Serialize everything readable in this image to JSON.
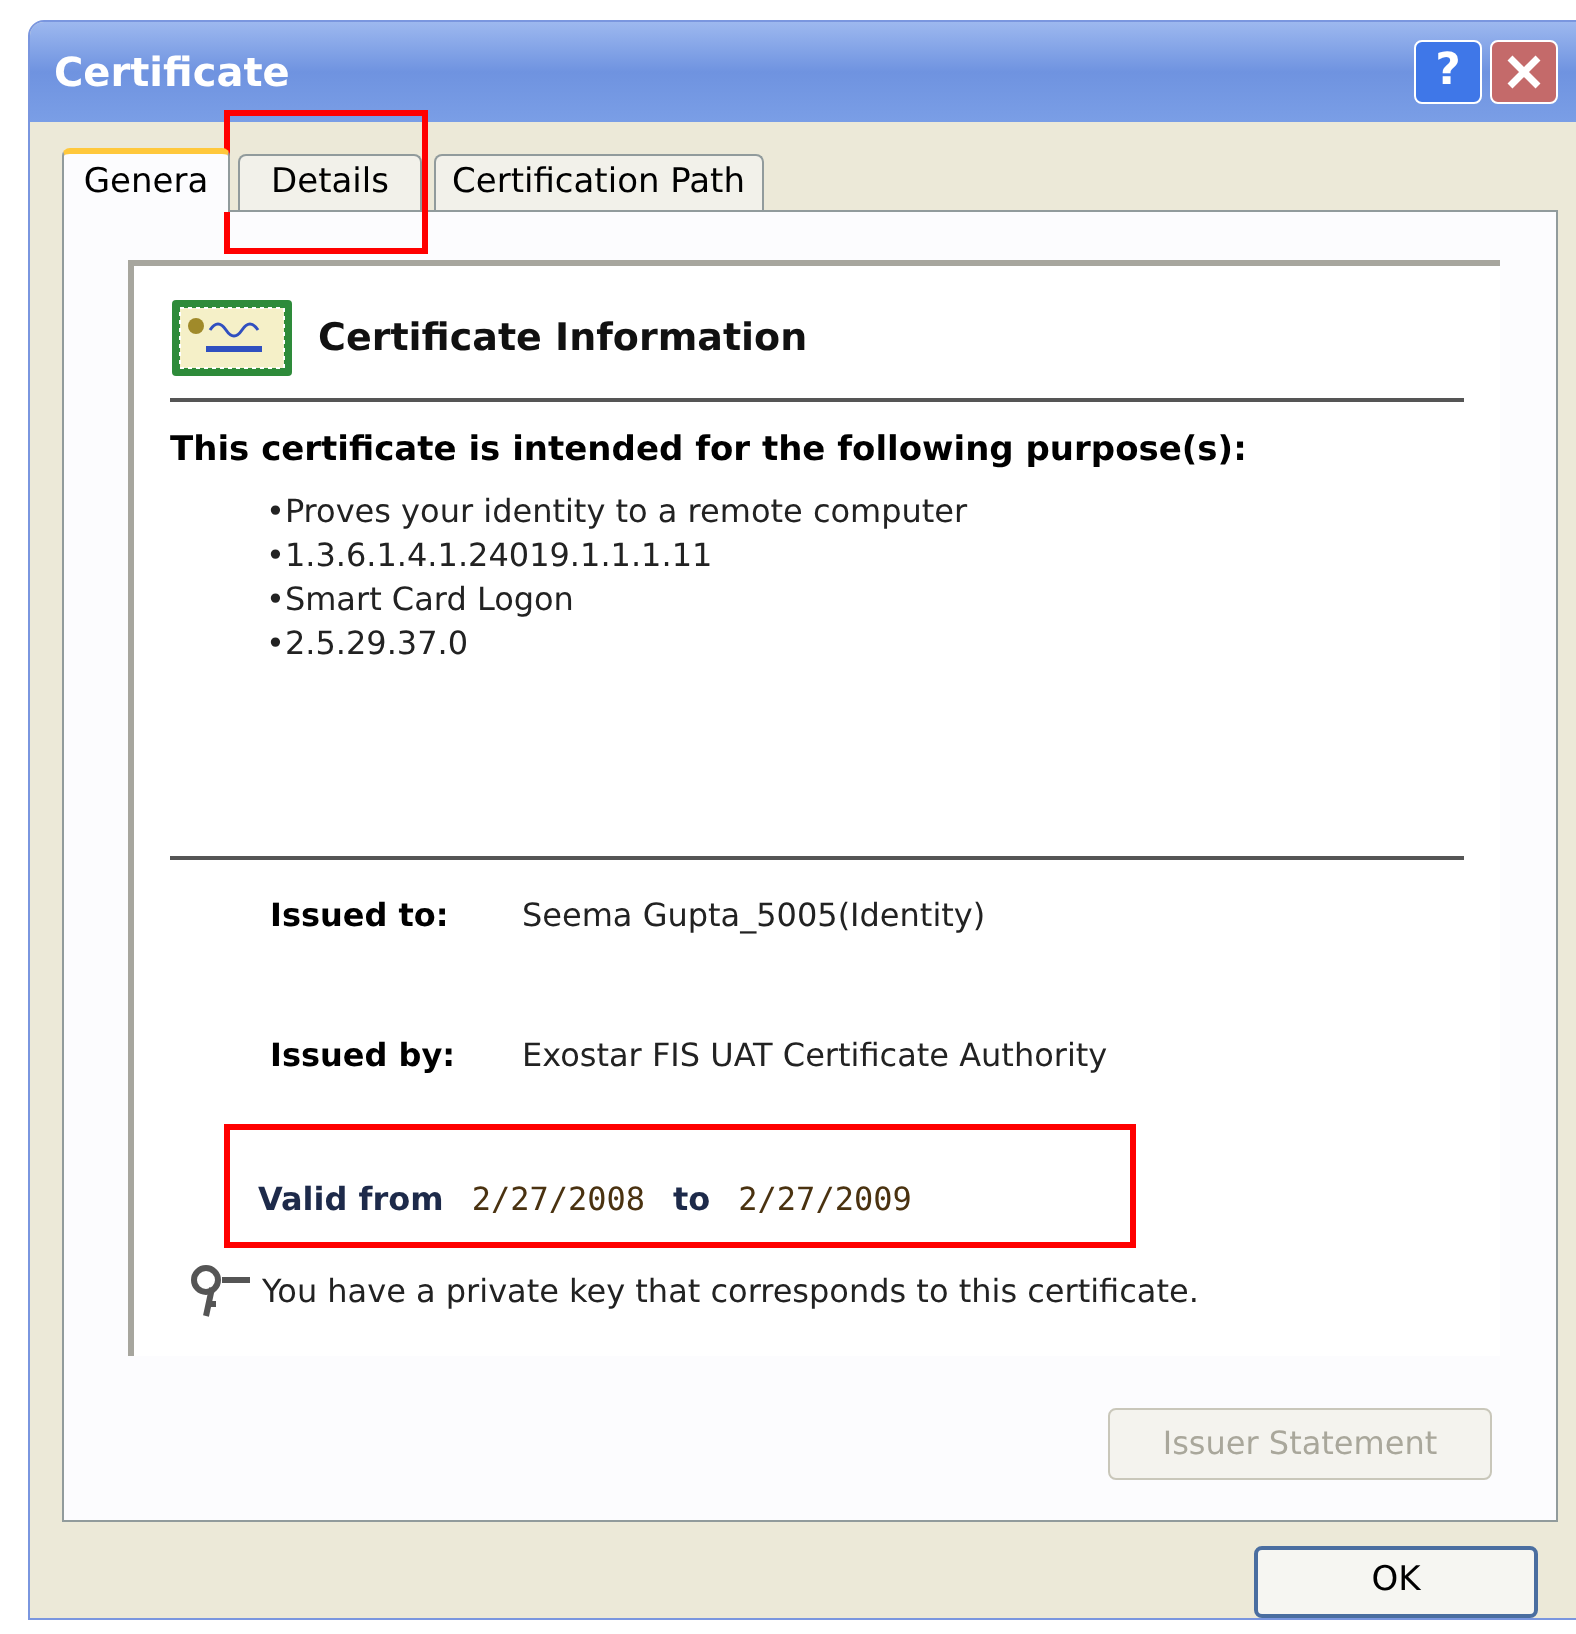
{
  "window": {
    "title": "Certificate",
    "help_button": "?"
  },
  "tabs": [
    {
      "label": "Genera",
      "selected": true
    },
    {
      "label": "Details",
      "selected": false
    },
    {
      "label": "Certification Path",
      "selected": false
    }
  ],
  "info": {
    "heading": "Certificate Information",
    "purpose_heading": "This certificate is intended for the following purpose(s):",
    "purposes": [
      "•Proves your identity to a remote computer",
      "•1.3.6.1.4.1.24019.1.1.1.11",
      "•Smart Card Logon",
      "•2.5.29.37.0"
    ],
    "issued_to": {
      "label": "Issued to:",
      "value": "Seema Gupta_5005(Identity)"
    },
    "issued_by": {
      "label": "Issued by:",
      "value": "Exostar FIS UAT Certificate Authority"
    },
    "validity": {
      "from_label": "Valid from",
      "from": "2/27/2008",
      "to_label": "to",
      "to": "2/27/2009"
    },
    "key_note": "You have a private key that corresponds to this certificate."
  },
  "issuer_statement": {
    "label": "Issuer Statement",
    "disabled": true
  },
  "ok_button": "OK"
}
